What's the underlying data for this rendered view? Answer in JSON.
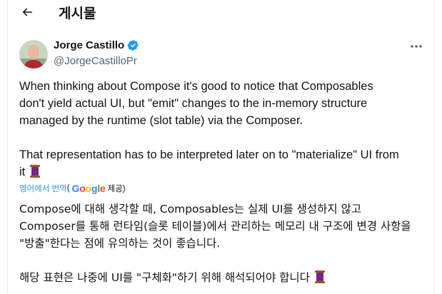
{
  "header": {
    "title": "게시물"
  },
  "author": {
    "name": "Jorge Castillo",
    "handle": "@JorgeCastilloPr"
  },
  "tweet": {
    "p1_lines": [
      "When thinking about Compose it's good to notice that Composables",
      "don't yield actual UI, but \"emit\" changes to the in-memory structure",
      "managed by the runtime (slot table) via the Composer."
    ],
    "p2_lines": [
      "That representation has to be interpreted later on to \"materialize\" UI from",
      "it"
    ]
  },
  "translation": {
    "link_label": "영어에서 번역",
    "open_paren": "(",
    "provider_suffix": "제공)",
    "kr1_lines": [
      "Compose에 대해 생각할 때, Composables는 실제 UI를 생성하지 않고",
      "Composer를 통해 런타임(슬롯 테이블)에서 관리하는 메모리 내 구조에 변경 사항을",
      "\"방출\"한다는 점에 유의하는 것이 좋습니다."
    ],
    "kr2_line": "해당 표현은 나중에 UI를 \"구체화\"하기 위해 해석되어야 합니다"
  },
  "icons": {
    "back": "arrow-left-icon",
    "verified": "verified-badge-icon",
    "more": "more-horizontal-icon",
    "emoji": "thread-spool-icon"
  },
  "colors": {
    "accent": "#1d9bf0",
    "secondary_text": "#536471",
    "border": "#eff3f4"
  }
}
